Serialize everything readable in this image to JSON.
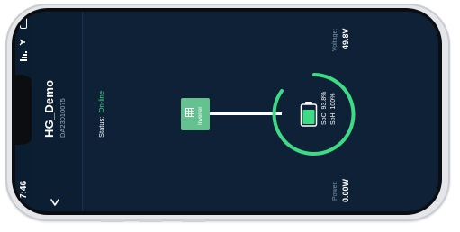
{
  "status_bar": {
    "time": "7:46",
    "signal_icon": "signal-bars-icon",
    "wifi_icon": "wifi-icon",
    "battery_icon": "battery-outline-icon"
  },
  "header": {
    "title": "HG_Demo",
    "subtitle": "DA23010075",
    "back_icon": "chevron-down-icon"
  },
  "status": {
    "label": "Status:",
    "value": "On-line"
  },
  "inverter": {
    "label": "Inverter"
  },
  "battery": {
    "soc_label": "SoC:",
    "soc_value": "93.8%",
    "soh_label": "SoH:",
    "soh_value": "100%",
    "ring_color": "#3ddc84"
  },
  "voltage": {
    "label": "Voltage:",
    "value": "49.8V"
  },
  "power": {
    "label": "Power:",
    "value": "0.00W"
  }
}
